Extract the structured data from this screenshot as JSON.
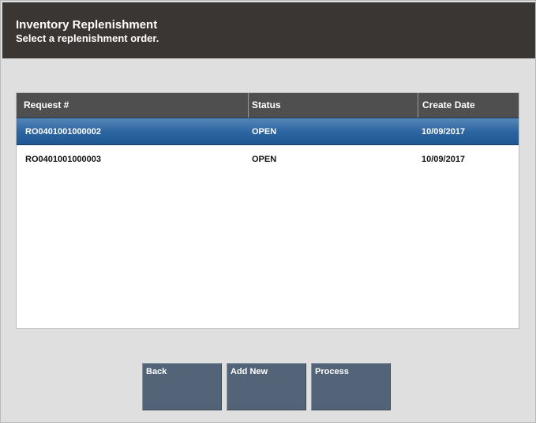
{
  "header": {
    "title": "Inventory Replenishment",
    "subtitle": "Select a replenishment order."
  },
  "table": {
    "columns": [
      "Request #",
      "Status",
      "Create Date"
    ],
    "rows": [
      {
        "request": "RO0401001000002",
        "status": "OPEN",
        "create_date": "10/09/2017",
        "selected": true
      },
      {
        "request": "RO0401001000003",
        "status": "OPEN",
        "create_date": "10/09/2017",
        "selected": false
      }
    ]
  },
  "buttons": {
    "back": "Back",
    "add_new": "Add New",
    "process": "Process"
  },
  "colors": {
    "header_bg": "#3a3633",
    "selected_row": "#2b64a0",
    "button_bg": "#536479"
  }
}
